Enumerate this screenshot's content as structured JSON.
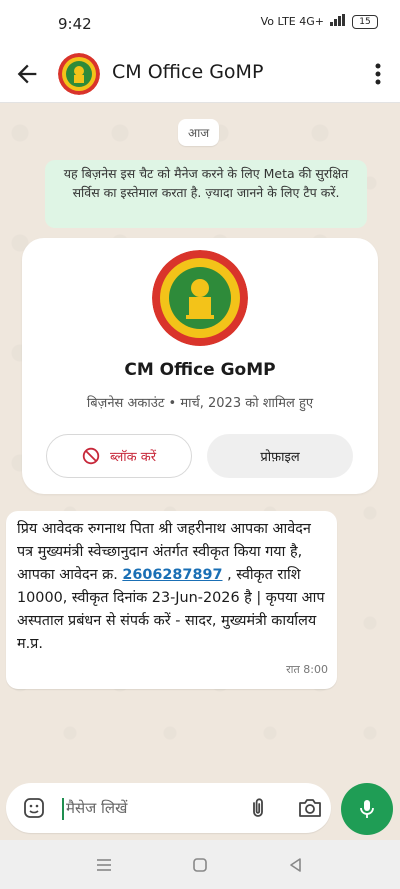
{
  "status_bar": {
    "time": "9:42",
    "network": "Vo LTE 4G+",
    "battery": "15"
  },
  "header": {
    "title": "CM Office GoMP"
  },
  "chat": {
    "date_chip": "आज",
    "notice": "यह बिज़नेस इस चैट को मैनेज करने के लिए Meta की सुरक्षित सर्विस का इस्तेमाल करता है. ज़्यादा जानने के लिए टैप करें.",
    "business_card": {
      "name": "CM Office GoMP",
      "subtitle": "बिज़नेस अकाउंट • मार्च, 2023 को शामिल हुए",
      "block_label": "ब्लॉक करें",
      "profile_label": "प्रोफ़ाइल"
    },
    "message": {
      "text_before": "प्रिय आवेदक रुगनाथ पिता श्री जहरीनाथ आपका आवेदन पत्र मुख्यमंत्री स्वेच्छानुदान अंतर्गत स्वीकृत किया गया है, आपका आवेदन क्र. ",
      "link_number": "2606287897",
      "text_after": " , स्वीकृत राशि 10000, स्वीकृत दिनांक 23-Jun-2026 है | कृपया आप अस्पताल प्रबंधन से संपर्क करें - सादर, मुख्यमंत्री कार्यालय म.प्र.",
      "time": "रात 8:00"
    }
  },
  "composer": {
    "placeholder": "मैसेज लिखें"
  },
  "colors": {
    "accent": "#1f9d55",
    "notice_bg": "#dff5e5",
    "block_red": "#c7283a",
    "link_blue": "#1a6fb5"
  },
  "icons": [
    "back-arrow-icon",
    "more-vert-icon",
    "block-icon",
    "emoji-icon",
    "attach-icon",
    "camera-icon",
    "mic-icon",
    "nav-menu-icon",
    "nav-home-icon",
    "nav-back-icon"
  ]
}
